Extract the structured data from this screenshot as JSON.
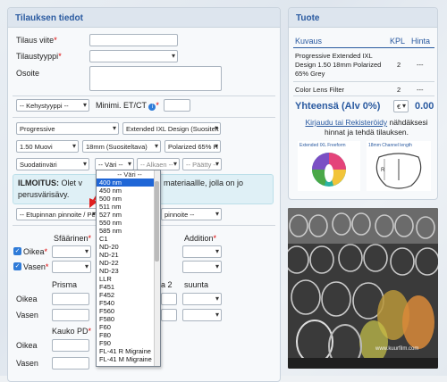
{
  "order_panel": {
    "title": "Tilauksen tiedot",
    "reference_label": "Tilaus viite",
    "order_type_label": "Tilaustyyppi",
    "address_label": "Osoite",
    "frame_type_value": "-- Kehystyyppi --",
    "min_et_ct_label": "Minimi. ET/CT",
    "lens_type_value": "Progressive",
    "lens_design_value": "Extended IXL Design (Suositelt",
    "index_value": "1.50 Muovi",
    "channel_value": "18mm (Suositeltava)",
    "coating_value": "Polarized 65% H",
    "filter_value": "Suodatinväri",
    "color_value": "-- Väri --",
    "start_value": "-- Alkaen --",
    "end_value": "-- Päätty --",
    "notice_bold": "ILMOITUS:",
    "notice_text_1": "Olet v",
    "notice_text_2": "materiaallle, jolla on jo",
    "notice_text_3": "perusvärisävy.",
    "coating_select_1": "-- Etupinnan pinnoite / Pe",
    "coating_select_2": "pinnoite --",
    "sphere_label": "Sfäärinen",
    "addition_label": "Addition",
    "right_label": "Oikea",
    "left_label": "Vasen",
    "prism_label": "Prisma",
    "direction_2_label": "a 2",
    "direction_label": "suunta",
    "right_label_2": "Oikea",
    "left_label_2": "Vasen",
    "far_pd_label": "Kauko PD",
    "right_label_3": "Oikea",
    "left_label_3": "Vasen"
  },
  "color_dropdown": {
    "options": [
      "-- Väri --",
      "400 nm",
      "450 nm",
      "500 nm",
      "511 nm",
      "527 nm",
      "550 nm",
      "585 nm",
      "C1",
      "ND-20",
      "ND-21",
      "ND-22",
      "ND-23",
      "LLR",
      "F451",
      "F452",
      "F540",
      "F560",
      "F580",
      "F60",
      "F80",
      "F90",
      "FL-41 R Migraine",
      "FL-41 M Migraine"
    ],
    "highlighted_index": 1
  },
  "product_panel": {
    "title": "Tuote",
    "col_description": "Kuvaus",
    "col_qty": "KPL",
    "col_price": "Hinta",
    "rows": [
      {
        "description": "Progressive Extended IXL Design 1.50 18mm Polarized 65% Grey",
        "qty": "2",
        "price": "---"
      },
      {
        "description": "Color Lens Filter",
        "qty": "2",
        "price": "---"
      }
    ],
    "total_label": "Yhteensä (Alv 0%)",
    "currency": "€",
    "total_value": "0.00",
    "login_link": "Kirjaudu tai Rekisteröidy",
    "login_text": "nähdäksesi hinnat ja tehdä tilauksen.",
    "diagram_1_title": "Extended IXL Freeform",
    "diagram_2_title": "18mm Channel length",
    "watermark": "www.kuurfilm.com"
  },
  "colors": {
    "accent": "#2a5aa0",
    "required": "#dd0000",
    "highlight": "#1f66d6",
    "arrow": "#e02020"
  }
}
